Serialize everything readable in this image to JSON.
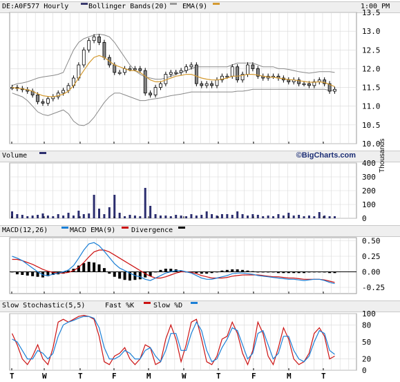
{
  "header": {
    "symbol": "DE:A0F577 Hourly",
    "bollinger_label": "Bollinger Bands(20)",
    "ema_label": "EMA(9)",
    "time": "1:00 PM"
  },
  "volume_header": {
    "label": "Volume",
    "credit": "©BigCharts.com"
  },
  "macd_header": {
    "label1": "MACD(12,26)",
    "label2": "MACD EMA(9)",
    "label3": "Divergence"
  },
  "stoch_header": {
    "label1": "Slow Stochastic(5,5)",
    "label2": "Fast %K",
    "label3": "Slow %D"
  },
  "colors": {
    "price": "#000000",
    "bollinger": "#888888",
    "ema": "#d49a30",
    "volume": "#2b2d6e",
    "macd": "#1a7fd6",
    "signal": "#cc1111",
    "fast_k": "#cc1111",
    "slow_d": "#1a7fd6",
    "grid": "#d8d8d8",
    "swatch_bb": "#3b3b6e"
  },
  "chart_data": [
    {
      "type": "candlestick",
      "title": "DE:A0F577 Hourly",
      "x_ticks": [
        "T",
        "W",
        "T",
        "F",
        "M",
        "W",
        "T",
        "F",
        "M",
        "T"
      ],
      "y_ticks": [
        "10.0",
        "10.5",
        "11.0",
        "11.5",
        "12.0",
        "12.5",
        "13.0",
        "13.5"
      ],
      "ylim": [
        10.0,
        13.5
      ],
      "series": [
        {
          "name": "Price",
          "values": [
            11.5,
            11.47,
            11.44,
            11.4,
            11.3,
            11.12,
            11.08,
            11.2,
            11.25,
            11.35,
            11.42,
            11.55,
            11.75,
            12.1,
            12.5,
            12.75,
            12.85,
            12.7,
            12.3,
            12.1,
            11.9,
            11.9,
            12.0,
            12.0,
            12.0,
            11.95,
            11.35,
            11.3,
            11.5,
            11.6,
            11.85,
            11.9,
            11.9,
            11.95,
            12.05,
            12.1,
            11.6,
            11.55,
            11.6,
            11.55,
            11.7,
            11.8,
            11.8,
            12.05,
            11.7,
            11.85,
            12.1,
            12.0,
            11.8,
            11.75,
            11.8,
            11.8,
            11.75,
            11.7,
            11.65,
            11.7,
            11.6,
            11.6,
            11.55,
            11.65,
            11.7,
            11.6,
            11.4,
            11.45
          ]
        },
        {
          "name": "Bollinger Bands(20) upper",
          "values": [
            11.55,
            11.6,
            11.62,
            11.65,
            11.7,
            11.75,
            11.78,
            11.8,
            11.82,
            11.85,
            11.9,
            12.2,
            12.5,
            12.7,
            12.8,
            12.85,
            12.9,
            12.92,
            12.9,
            12.85,
            12.7,
            12.5,
            12.3,
            12.1,
            11.95,
            11.85,
            11.78,
            11.75,
            11.72,
            11.72,
            11.75,
            11.8,
            11.85,
            11.9,
            11.95,
            12.0,
            12.05,
            12.05,
            12.05,
            12.05,
            12.05,
            12.05,
            12.05,
            12.1,
            12.15,
            12.15,
            12.15,
            12.15,
            12.1,
            12.05,
            12.05,
            12.05,
            12.0,
            12.0,
            11.98,
            11.95,
            11.92,
            11.9,
            11.88,
            11.9,
            11.92,
            11.92,
            11.92,
            11.9
          ]
        },
        {
          "name": "Bollinger Bands(20) lower",
          "values": [
            11.35,
            11.3,
            11.25,
            11.15,
            11.0,
            10.85,
            10.78,
            10.75,
            10.8,
            10.85,
            10.9,
            10.8,
            10.6,
            10.5,
            10.48,
            10.55,
            10.7,
            10.9,
            11.1,
            11.25,
            11.35,
            11.35,
            11.3,
            11.25,
            11.2,
            11.15,
            11.15,
            11.18,
            11.2,
            11.22,
            11.25,
            11.28,
            11.3,
            11.32,
            11.35,
            11.38,
            11.38,
            11.38,
            11.38,
            11.38,
            11.38,
            11.38,
            11.38,
            11.38,
            11.4,
            11.4,
            11.42,
            11.45,
            11.45,
            11.45,
            11.45,
            11.45,
            11.45,
            11.45,
            11.45,
            11.45,
            11.45,
            11.45,
            11.45,
            11.45,
            11.45,
            11.45,
            11.42,
            11.42
          ]
        },
        {
          "name": "EMA(9)",
          "values": [
            11.5,
            11.48,
            11.46,
            11.44,
            11.4,
            11.33,
            11.28,
            11.26,
            11.25,
            11.28,
            11.32,
            11.4,
            11.55,
            11.75,
            11.95,
            12.15,
            12.3,
            12.35,
            12.3,
            12.2,
            12.1,
            12.05,
            12.0,
            11.95,
            11.95,
            11.9,
            11.8,
            11.7,
            11.65,
            11.65,
            11.7,
            11.75,
            11.8,
            11.82,
            11.85,
            11.85,
            11.8,
            11.75,
            11.72,
            11.7,
            11.7,
            11.72,
            11.75,
            11.8,
            11.8,
            11.82,
            11.85,
            11.85,
            11.83,
            11.8,
            11.78,
            11.77,
            11.75,
            11.73,
            11.71,
            11.7,
            11.68,
            11.66,
            11.64,
            11.64,
            11.65,
            11.63,
            11.58,
            11.52
          ]
        }
      ]
    },
    {
      "type": "bar",
      "title": "Volume",
      "ylabel": "Thousands",
      "y_ticks": [
        "0",
        "100",
        "200",
        "300",
        "400"
      ],
      "ylim": [
        0,
        400
      ],
      "values": [
        50,
        30,
        25,
        15,
        20,
        25,
        35,
        20,
        15,
        30,
        20,
        40,
        20,
        55,
        30,
        35,
        170,
        70,
        30,
        80,
        170,
        40,
        15,
        25,
        20,
        15,
        220,
        90,
        30,
        20,
        20,
        15,
        25,
        20,
        15,
        30,
        20,
        25,
        50,
        30,
        20,
        30,
        30,
        25,
        50,
        30,
        20,
        30,
        25,
        15,
        20,
        15,
        30,
        20,
        40,
        20,
        25,
        15,
        20,
        15,
        45,
        20,
        15,
        15
      ]
    },
    {
      "type": "line",
      "title": "MACD(12,26)",
      "y_ticks": [
        "0.50",
        "0.25",
        "0.00",
        "-0.25"
      ],
      "ylim": [
        -0.35,
        0.55
      ],
      "series": [
        {
          "name": "MACD EMA(9)",
          "values": [
            0.25,
            0.22,
            0.18,
            0.12,
            0.06,
            0.0,
            -0.05,
            -0.06,
            -0.04,
            -0.02,
            0.0,
            0.03,
            0.1,
            0.22,
            0.35,
            0.45,
            0.47,
            0.42,
            0.33,
            0.23,
            0.13,
            0.06,
            0.02,
            -0.02,
            -0.06,
            -0.08,
            -0.12,
            -0.14,
            -0.1,
            -0.06,
            -0.02,
            0.0,
            0.02,
            0.02,
            0.0,
            -0.02,
            -0.06,
            -0.1,
            -0.12,
            -0.12,
            -0.1,
            -0.08,
            -0.06,
            -0.03,
            -0.02,
            -0.02,
            -0.03,
            -0.04,
            -0.06,
            -0.07,
            -0.08,
            -0.09,
            -0.1,
            -0.11,
            -0.12,
            -0.12,
            -0.13,
            -0.14,
            -0.13,
            -0.12,
            -0.12,
            -0.14,
            -0.17,
            -0.19
          ]
        },
        {
          "name": "Signal",
          "values": [
            0.2,
            0.2,
            0.18,
            0.15,
            0.12,
            0.08,
            0.04,
            0.01,
            -0.01,
            -0.02,
            -0.02,
            -0.01,
            0.02,
            0.07,
            0.15,
            0.24,
            0.32,
            0.35,
            0.35,
            0.32,
            0.27,
            0.22,
            0.17,
            0.12,
            0.07,
            0.02,
            -0.03,
            -0.07,
            -0.1,
            -0.1,
            -0.08,
            -0.05,
            -0.02,
            0.0,
            0.0,
            -0.01,
            -0.03,
            -0.06,
            -0.08,
            -0.1,
            -0.1,
            -0.1,
            -0.09,
            -0.07,
            -0.06,
            -0.05,
            -0.05,
            -0.05,
            -0.05,
            -0.06,
            -0.07,
            -0.08,
            -0.08,
            -0.09,
            -0.1,
            -0.1,
            -0.11,
            -0.12,
            -0.12,
            -0.12,
            -0.12,
            -0.13,
            -0.15,
            -0.17
          ]
        },
        {
          "name": "Divergence",
          "values": [
            0.0,
            -0.04,
            -0.05,
            -0.06,
            -0.07,
            -0.08,
            -0.09,
            -0.07,
            -0.05,
            -0.04,
            -0.03,
            0.02,
            0.05,
            0.1,
            0.14,
            0.16,
            0.15,
            0.12,
            0.06,
            -0.03,
            -0.08,
            -0.11,
            -0.13,
            -0.14,
            -0.13,
            -0.12,
            -0.09,
            -0.07,
            0.0,
            0.03,
            0.05,
            0.05,
            0.04,
            0.02,
            0.0,
            -0.01,
            -0.02,
            -0.03,
            -0.03,
            -0.02,
            0.0,
            0.02,
            0.03,
            0.04,
            0.04,
            0.03,
            0.02,
            0.01,
            -0.01,
            -0.01,
            -0.01,
            -0.01,
            -0.02,
            -0.02,
            -0.02,
            -0.02,
            -0.02,
            -0.02,
            -0.01,
            0.0,
            0.0,
            -0.01,
            -0.02,
            -0.02
          ]
        }
      ]
    },
    {
      "type": "line",
      "title": "Slow Stochastic(5,5)",
      "y_ticks": [
        "100",
        "80",
        "50",
        "20",
        "0"
      ],
      "ylim": [
        0,
        100
      ],
      "series": [
        {
          "name": "Fast %K",
          "values": [
            65,
            45,
            20,
            10,
            25,
            45,
            20,
            10,
            40,
            85,
            90,
            85,
            90,
            95,
            97,
            95,
            90,
            60,
            15,
            10,
            25,
            30,
            40,
            20,
            10,
            20,
            45,
            40,
            10,
            15,
            55,
            80,
            55,
            15,
            45,
            85,
            90,
            55,
            15,
            10,
            25,
            55,
            60,
            85,
            65,
            30,
            10,
            35,
            85,
            65,
            25,
            10,
            40,
            75,
            55,
            20,
            10,
            15,
            30,
            65,
            75,
            60,
            20,
            25
          ]
        },
        {
          "name": "Slow %D",
          "values": [
            55,
            50,
            35,
            20,
            20,
            35,
            30,
            20,
            30,
            60,
            80,
            85,
            88,
            92,
            95,
            95,
            92,
            75,
            40,
            20,
            20,
            25,
            35,
            30,
            20,
            20,
            35,
            40,
            25,
            15,
            35,
            65,
            65,
            35,
            35,
            65,
            85,
            70,
            35,
            15,
            20,
            40,
            55,
            75,
            70,
            45,
            20,
            30,
            65,
            70,
            45,
            20,
            30,
            60,
            60,
            35,
            20,
            15,
            25,
            50,
            70,
            65,
            35,
            28
          ]
        }
      ]
    }
  ]
}
